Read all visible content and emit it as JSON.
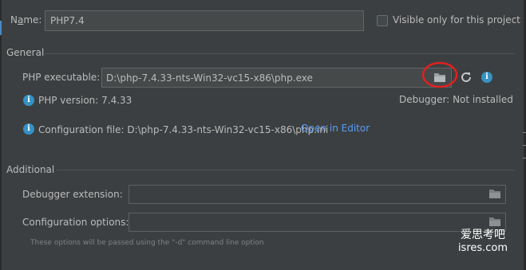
{
  "name_field": {
    "label": "Name:",
    "mnemonic": "a",
    "value": "PHP7.4"
  },
  "visible_only": {
    "label": "Visible only for this project",
    "checked": false
  },
  "general": {
    "title": "General",
    "php_executable": {
      "label": "PHP executable:",
      "value": "D:\\php-7.4.33-nts-Win32-vc15-x86\\php.exe"
    },
    "php_version": {
      "label": "PHP version: 7.4.33"
    },
    "debugger": {
      "label": "Debugger:",
      "value": "Not installed"
    },
    "config_file": {
      "label": "Configuration file: D:\\php-7.4.33-nts-Win32-vc15-x86\\php.ini",
      "link": "Open in Editor"
    }
  },
  "additional": {
    "title": "Additional",
    "debugger_extension": {
      "label": "Debugger extension:",
      "value": ""
    },
    "config_options": {
      "label": "Configuration options:",
      "value": ""
    },
    "hint": "These options will be passed using the \"-d\" command line option"
  },
  "watermark": {
    "line1": "爱思考吧",
    "line2": "isres.com"
  },
  "colors": {
    "background": "#3c3f41",
    "link": "#589df6",
    "info_icon": "#3592c4",
    "highlight_circle": "#e02020"
  },
  "icons": [
    "folder-icon",
    "refresh-icon",
    "info-icon"
  ]
}
